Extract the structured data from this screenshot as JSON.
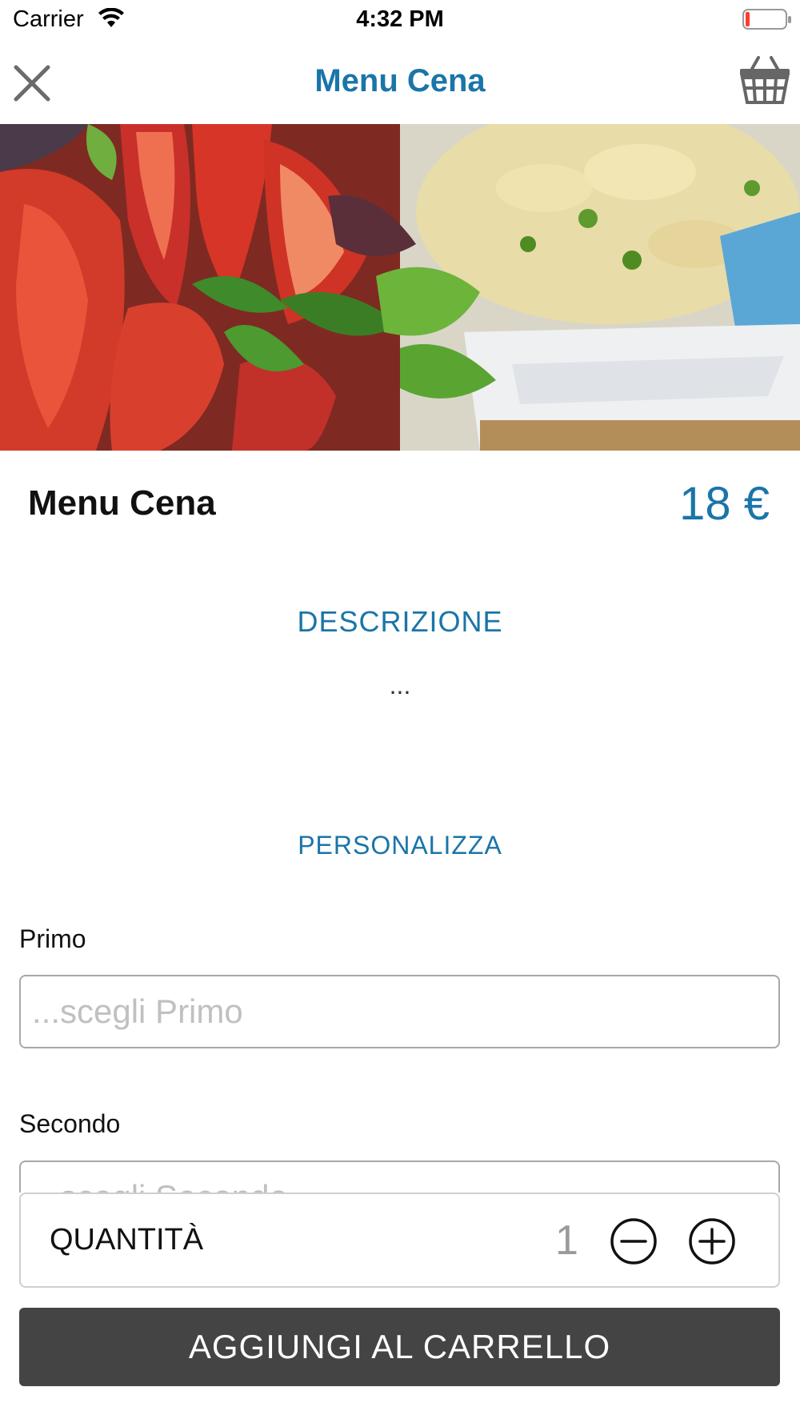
{
  "status_bar": {
    "carrier": "Carrier",
    "time": "4:32 PM"
  },
  "nav": {
    "title": "Menu Cena",
    "close_icon": "close-icon",
    "basket_icon": "basket-icon"
  },
  "product": {
    "name": "Menu Cena",
    "price": "18 €"
  },
  "description": {
    "title": "DESCRIZIONE",
    "text": "..."
  },
  "customize": {
    "title": "PERSONALIZZA",
    "fields": [
      {
        "label": "Primo",
        "placeholder": "...scegli Primo"
      },
      {
        "label": "Secondo",
        "placeholder": "...scegli Secondo"
      }
    ]
  },
  "quantity": {
    "label": "QUANTITÀ",
    "value": "1"
  },
  "actions": {
    "add_to_cart": "AGGIUNGI AL CARRELLO"
  },
  "colors": {
    "accent": "#1a75a8",
    "button_bg": "#444444"
  }
}
